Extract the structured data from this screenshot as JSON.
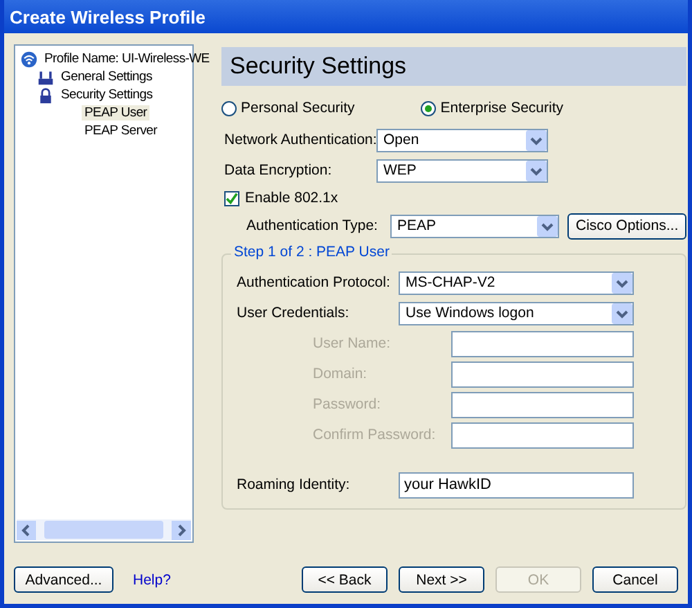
{
  "window": {
    "title": "Create Wireless Profile"
  },
  "tree": {
    "items": [
      {
        "label": "Profile Name: UI-Wireless-WE",
        "selected": false,
        "children": [
          {
            "label": "General Settings",
            "selected": false
          },
          {
            "label": "Security Settings",
            "selected": false,
            "children": [
              {
                "label": "PEAP User",
                "selected": true
              },
              {
                "label": "PEAP Server",
                "selected": false
              }
            ]
          }
        ]
      }
    ]
  },
  "header": "Security Settings",
  "security_mode": [
    {
      "label": "Personal Security",
      "selected": false
    },
    {
      "label": "Enterprise Security",
      "selected": true
    }
  ],
  "network_authentication": {
    "label": "Network Authentication:",
    "value": "Open"
  },
  "data_encryption": {
    "label": "Data Encryption:",
    "value": "WEP"
  },
  "enable_8021x": {
    "label": "Enable 802.1x",
    "checked": true
  },
  "authentication_type": {
    "label": "Authentication Type:",
    "value": "PEAP"
  },
  "cisco_options": "Cisco Options...",
  "group": {
    "title": "Step 1 of 2 : PEAP User",
    "authentication_protocol": {
      "label": "Authentication Protocol:",
      "value": "MS-CHAP-V2"
    },
    "user_credentials": {
      "label": "User Credentials:",
      "value": "Use Windows logon"
    },
    "fields": [
      {
        "label": "User Name:",
        "disabled": true
      },
      {
        "label": "Domain:",
        "disabled": true
      },
      {
        "label": "Password:",
        "disabled": true
      },
      {
        "label": "Confirm Password:",
        "disabled": true
      }
    ],
    "roaming_identity": {
      "label": "Roaming Identity:",
      "value": "your HawkID"
    }
  },
  "buttons": [
    {
      "label": "Advanced...",
      "kind": "button",
      "disabled": false
    },
    {
      "label": "Help?",
      "kind": "link",
      "disabled": false
    },
    {
      "label": "<< Back",
      "kind": "button",
      "disabled": false
    },
    {
      "label": "Next >>",
      "kind": "button",
      "disabled": false
    },
    {
      "label": "OK",
      "kind": "button",
      "disabled": true
    },
    {
      "label": "Cancel",
      "kind": "button",
      "disabled": false
    }
  ]
}
